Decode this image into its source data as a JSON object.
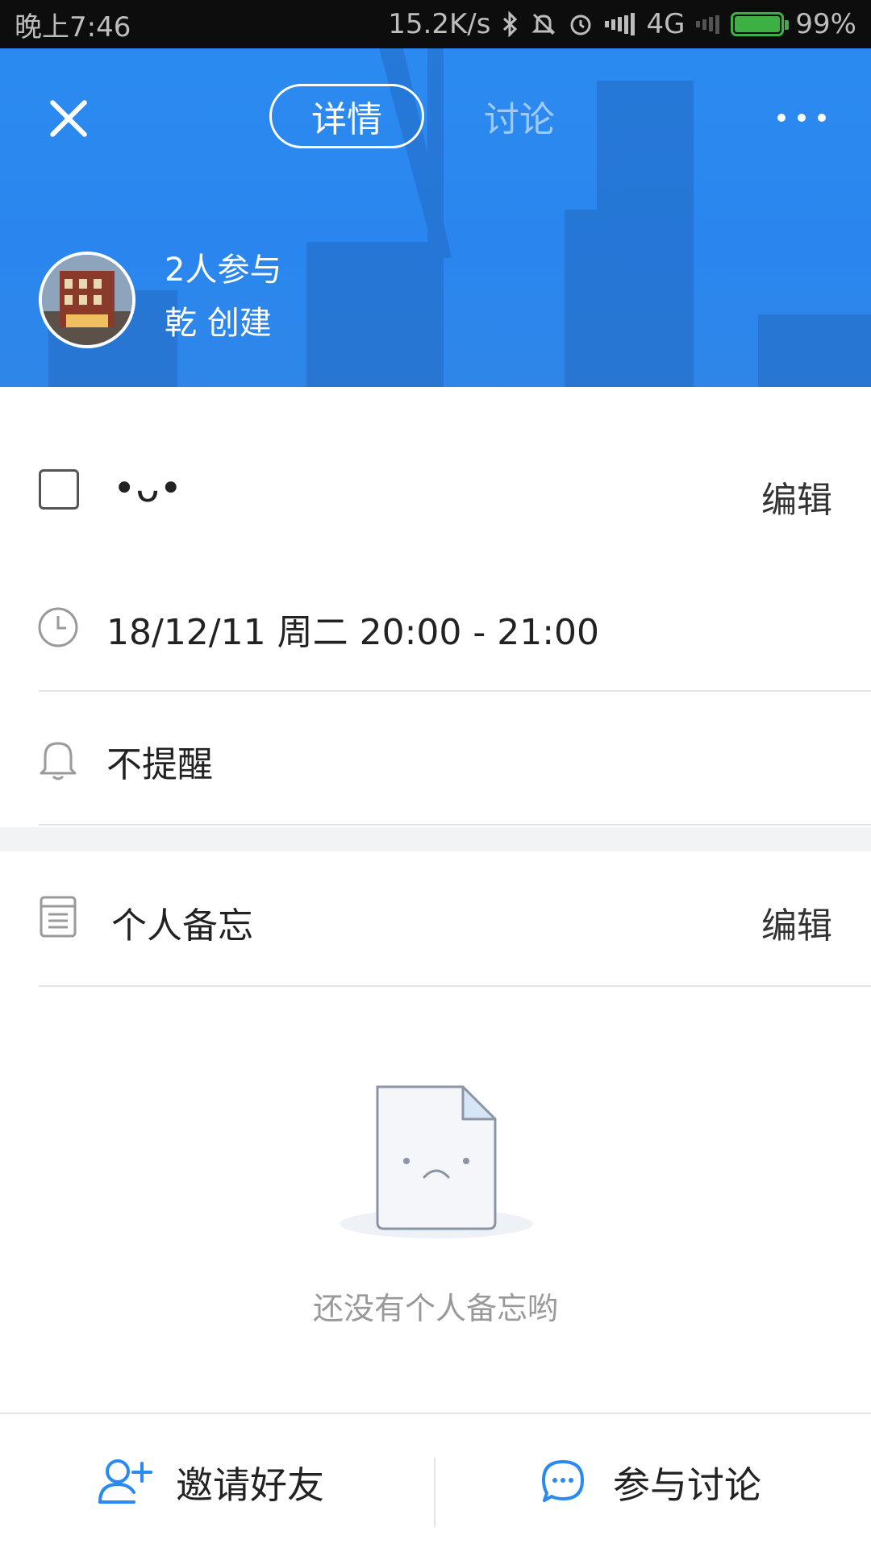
{
  "statusbar": {
    "time": "晚上7:46",
    "speed": "15.2K/s",
    "network": "4G",
    "battery": "99%",
    "icons": [
      "bluetooth-icon",
      "mute-icon",
      "alarm-icon",
      "signal-icon",
      "battery-icon"
    ]
  },
  "header": {
    "tabs": {
      "detail": "详情",
      "discussion": "讨论"
    },
    "participants": "2人参与",
    "creator": "乾  创建",
    "accent_color": "#2b8af0"
  },
  "event": {
    "title": "•ᴗ•",
    "edit_label": "编辑",
    "time": "18/12/11 周二 20:00 - 21:00",
    "reminder": "不提醒"
  },
  "memo": {
    "label": "个人备忘",
    "edit_label": "编辑",
    "empty_text": "还没有个人备忘哟"
  },
  "bottom": {
    "invite_label": "邀请好友",
    "discuss_label": "参与讨论",
    "icon_color": "#2b8af0"
  }
}
